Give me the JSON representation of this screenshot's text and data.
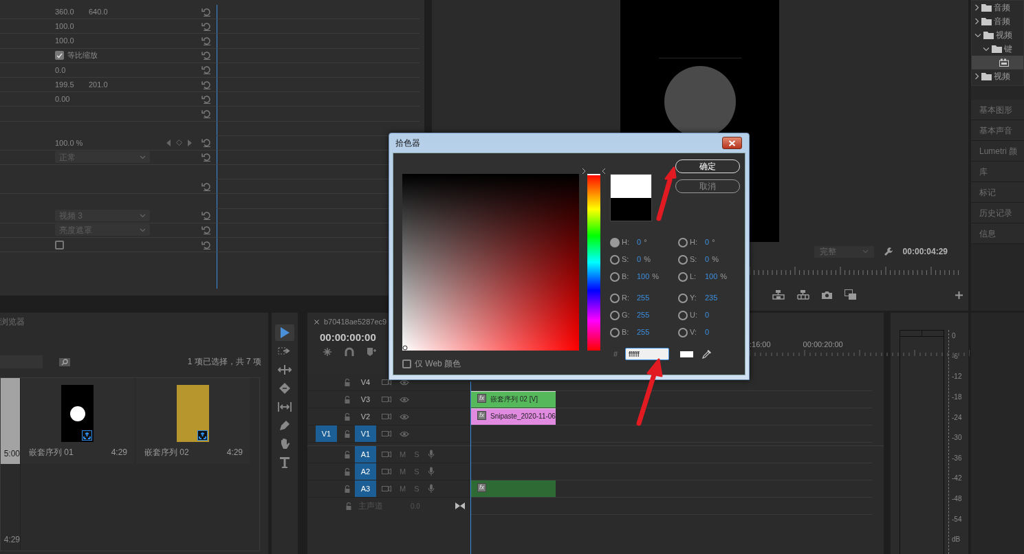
{
  "effect_controls": {
    "rows": [
      {
        "kind": "pair",
        "values": [
          "360.0",
          "640.0"
        ],
        "reset": true
      },
      {
        "kind": "pair",
        "values": [
          "100.0"
        ],
        "reset": true
      },
      {
        "kind": "pair",
        "values": [
          "100.0"
        ],
        "reset": true
      },
      {
        "kind": "checkbox",
        "label": "等比缩放",
        "checked": true,
        "reset": true
      },
      {
        "kind": "pair",
        "values": [
          "0.0"
        ],
        "reset": true
      },
      {
        "kind": "pair",
        "values": [
          "199.5",
          "201.0"
        ],
        "reset": true
      },
      {
        "kind": "pair",
        "values": [
          "0.00"
        ],
        "reset": true
      },
      {
        "kind": "blank",
        "reset": true
      },
      {
        "kind": "blank",
        "reset": false
      },
      {
        "kind": "keyframe",
        "values": [
          "100.0 %"
        ],
        "reset": true
      },
      {
        "kind": "dropdown",
        "value": "正常",
        "reset": true
      },
      {
        "kind": "blank",
        "reset": false
      },
      {
        "kind": "blank",
        "reset": true
      },
      {
        "kind": "blank",
        "reset": false
      },
      {
        "kind": "dropdown",
        "value": "视频 3",
        "reset": true
      },
      {
        "kind": "dropdown",
        "value": "亮度遮罩",
        "reset": true
      },
      {
        "kind": "checkbox",
        "checked": false,
        "reset": true
      }
    ]
  },
  "program_monitor": {
    "zoom": "完整",
    "timecode": "00:00:04:29"
  },
  "effects_tree": [
    {
      "kind": "folder",
      "label": "音频",
      "expanded": false,
      "selected": false
    },
    {
      "kind": "folder",
      "label": "音频",
      "expanded": false,
      "selected": false
    },
    {
      "kind": "folder",
      "label": "视频",
      "expanded": true,
      "selected": false,
      "children": [
        {
          "kind": "folder",
          "label": "键",
          "expanded": true,
          "selected": false,
          "children": [
            {
              "kind": "item",
              "selected": true
            }
          ]
        }
      ]
    },
    {
      "kind": "folder",
      "label": "视频",
      "expanded": false,
      "selected": false
    }
  ],
  "side_panels": [
    "基本图形",
    "基本声音",
    "Lumetri 颜",
    "库",
    "标记",
    "历史记录",
    "信息"
  ],
  "project": {
    "title": "浏览器",
    "selection_count": "1 项已选择，共 7 项",
    "items": [
      {
        "kind": "plain",
        "duration": "5:00",
        "selected": true
      },
      {
        "kind": "circle",
        "name": "嵌套序列 01",
        "duration": "4:29",
        "selected": false
      },
      {
        "kind": "photo",
        "name": "嵌套序列 02",
        "duration": "4:29",
        "selected": false
      },
      {
        "kind": "plain",
        "duration": "4:29",
        "selected": false
      }
    ]
  },
  "tools": [
    {
      "kind": "select",
      "selected": true
    },
    {
      "kind": "track-select",
      "selected": false
    },
    {
      "kind": "ripple",
      "selected": false
    },
    {
      "kind": "razor",
      "selected": false
    },
    {
      "kind": "slip",
      "selected": false
    },
    {
      "kind": "pen",
      "selected": false
    },
    {
      "kind": "hand",
      "selected": false
    },
    {
      "kind": "type",
      "selected": false
    }
  ],
  "timeline": {
    "tab": "b70418ae5287ec9",
    "timecode": "00:00:00:00",
    "ruler_labels": [
      ":16:00",
      "00:00:20:00"
    ],
    "video_tracks": [
      {
        "name": "V4",
        "targeted": false
      },
      {
        "name": "V3",
        "targeted": false,
        "clip": {
          "badge": "fx",
          "label": "嵌套序列 02 [V]",
          "color": "#55b95c"
        }
      },
      {
        "name": "V2",
        "targeted": false,
        "clip": {
          "badge": "fx",
          "label": "Snipaste_2020-11-06",
          "color": "#e08ae0"
        }
      },
      {
        "name": "V1",
        "targeted": true,
        "source": "V1"
      }
    ],
    "audio_tracks": [
      {
        "name": "A1",
        "targeted": true,
        "mute": "M",
        "solo": "S"
      },
      {
        "name": "A2",
        "targeted": true,
        "mute": "M",
        "solo": "S"
      },
      {
        "name": "A3",
        "targeted": true,
        "mute": "M",
        "solo": "S",
        "clip": {
          "badge": "fx",
          "color": "#2e6a33"
        }
      }
    ],
    "master": {
      "name": "主声道",
      "value": "0.0"
    }
  },
  "audio_meter": {
    "scale": [
      "0",
      "-6",
      "-12",
      "-18",
      "-24",
      "-30",
      "-36",
      "-42",
      "-48",
      "-54",
      "dB"
    ]
  },
  "color_picker": {
    "title": "拾色器",
    "buttons": [
      {
        "label": "确定",
        "default": true
      },
      {
        "label": "取消",
        "default": false
      }
    ],
    "hue_slider": {
      "level": 0
    },
    "left_fields": [
      {
        "label": "H:",
        "value": "0",
        "unit": "°",
        "selected": true
      },
      {
        "label": "S:",
        "value": "0",
        "unit": "%",
        "selected": false
      },
      {
        "label": "B:",
        "value": "100",
        "unit": "%",
        "selected": false
      },
      {
        "label": "R:",
        "value": "255",
        "selected": false
      },
      {
        "label": "G:",
        "value": "255",
        "selected": false
      },
      {
        "label": "B:",
        "value": "255",
        "selected": false
      }
    ],
    "right_fields": [
      {
        "label": "H:",
        "value": "0",
        "unit": "°",
        "selected": false
      },
      {
        "label": "S:",
        "value": "0",
        "unit": "%",
        "selected": false
      },
      {
        "label": "L:",
        "value": "100",
        "unit": "%",
        "selected": false
      },
      {
        "label": "Y:",
        "value": "235",
        "selected": false
      },
      {
        "label": "U:",
        "value": "0",
        "selected": false
      },
      {
        "label": "V:",
        "value": "0",
        "selected": false
      }
    ],
    "hex_label": "#",
    "hex": "ffffff",
    "web_only": {
      "label": "仅 Web 颜色",
      "checked": false
    }
  }
}
